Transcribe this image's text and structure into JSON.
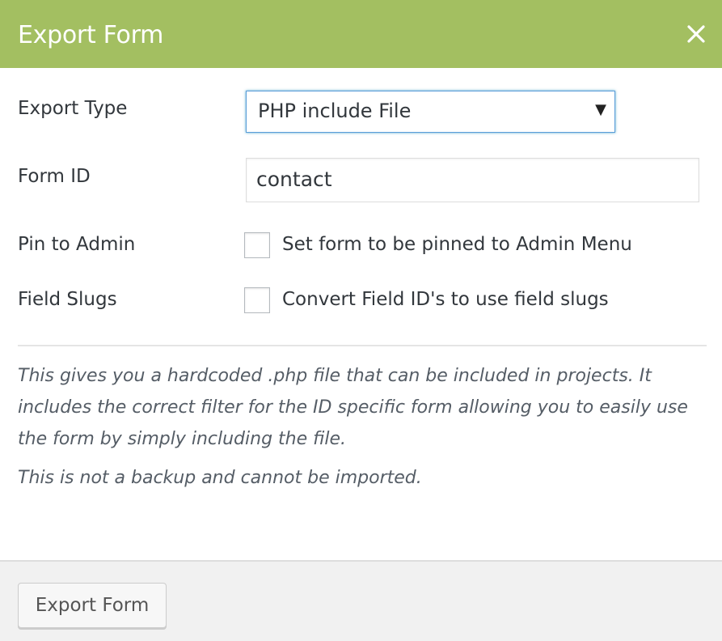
{
  "header": {
    "title": "Export Form",
    "close_icon": "close-icon",
    "background_color": "#a3bf61"
  },
  "form": {
    "export_type": {
      "label": "Export Type",
      "selected_value": "PHP include File",
      "arrow_glyph": "▼"
    },
    "form_id": {
      "label": "Form ID",
      "value": "contact"
    },
    "pin_to_admin": {
      "label": "Pin to Admin",
      "checkbox_label": "Set form to be pinned to Admin Menu",
      "checked": false
    },
    "field_slugs": {
      "label": "Field Slugs",
      "checkbox_label": "Convert Field ID's to use field slugs",
      "checked": false
    }
  },
  "description": {
    "line1": "This gives you a hardcoded .php file that can be included in projects. It includes the correct filter for the ID specific form allowing you to easily use the form by simply including the file.",
    "line2": "This is not a backup and cannot be imported."
  },
  "footer": {
    "button_label": "Export Form"
  }
}
